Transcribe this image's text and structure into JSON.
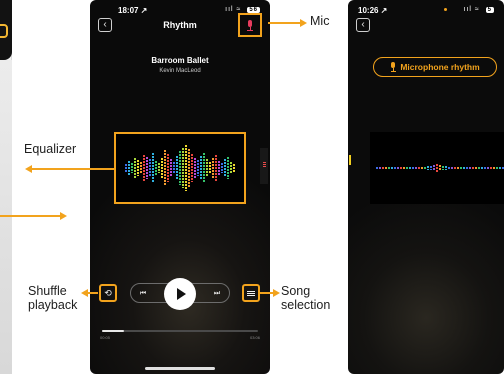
{
  "main_phone": {
    "status_time": "18:07 ↗",
    "status_right": "ııl ≈",
    "battery": "56",
    "title": "Rhythm",
    "song_title": "Barroom Ballet",
    "artist": "Kevin MacLeod",
    "time_elapsed": "00:05",
    "time_total": "03:06",
    "progress_percent": 14,
    "icons": {
      "back": "back-chevron-icon",
      "mic": "microphone-icon",
      "shuffle": "shuffle-repeat-icon",
      "prev": "skip-previous-icon",
      "play": "play-icon",
      "next": "skip-next-icon",
      "song_list": "list-icon"
    }
  },
  "right_phone": {
    "status_time": "10:26 ↗",
    "status_right": "ııl ≈",
    "battery": "5",
    "mic_rhythm_label": "Microphone rhythm"
  },
  "annotations": {
    "mic": "Mic",
    "equalizer": "Equalizer",
    "shuffle_line1": "Shuffle",
    "shuffle_line2": "playback",
    "song_line1": "Song",
    "song_line2": "selection"
  },
  "colors": {
    "accent": "#f2a31d",
    "mic_active": "#e83c5e",
    "background": "#0a0a0a"
  }
}
